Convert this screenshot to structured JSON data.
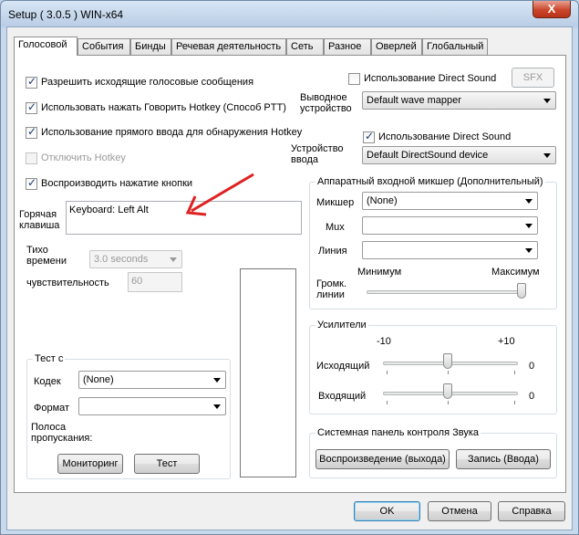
{
  "window": {
    "title": "Setup ( 3.0.5 ) WIN-x64",
    "close_label": "X"
  },
  "tabs": [
    {
      "label": "Голосовой",
      "active": true
    },
    {
      "label": "События"
    },
    {
      "label": "Бинды"
    },
    {
      "label": "Речевая деятельность"
    },
    {
      "label": "Сеть"
    },
    {
      "label": "Разное"
    },
    {
      "label": "Оверлей"
    },
    {
      "label": "Глобальный"
    }
  ],
  "voice": {
    "allow_outgoing": "Разрешить исходящие голосовые сообщения",
    "use_ptt": "Использовать нажать Говорить Hotkey (Способ PTT)",
    "use_direct_detect": "Использование прямого ввода для обнаружения Hotkey",
    "disable_hotkey": "Отключить Hotkey",
    "play_key_press": "Воспроизводить нажатие кнопки",
    "hotkey_label": "Горячая\nклавиша",
    "hotkey_value": "Keyboard: Left Alt",
    "silence_label": "Тихо\nвремени",
    "silence_value": "3.0 seconds",
    "sensitivity_label": "чувствительность",
    "sensitivity_value": "60"
  },
  "output": {
    "use_direct_sound": "Использование Direct Sound",
    "sfx_button": "SFX",
    "device_label": "Выводное\nустройство",
    "device_value": "Default wave mapper"
  },
  "input": {
    "use_direct_sound": "Использование Direct Sound",
    "device_label": "Устройство\nввода",
    "device_value": "Default DirectSound device"
  },
  "mixer": {
    "title": "Аппаратный входной микшер (Дополнительный)",
    "mixer_label": "Микшер",
    "mixer_value": "(None)",
    "mux_label": "Mux",
    "line_label": "Линия",
    "volume_label": "Громк.\nлинии",
    "min_label": "Минимум",
    "max_label": "Максимум"
  },
  "amps": {
    "title": "Усилители",
    "min_label": "-10",
    "max_label": "+10",
    "outgoing_label": "Исходящий",
    "outgoing_value": "0",
    "incoming_label": "Входящий",
    "incoming_value": "0"
  },
  "sound_panel": {
    "title": "Системная панель контроля Звука",
    "playback_button": "Воспроизведение (выхода)",
    "record_button": "Запись (Ввода)"
  },
  "test": {
    "title": "Тест с",
    "codec_label": "Кодек",
    "codec_value": "(None)",
    "format_label": "Формат",
    "bandwidth_label": "Полоса\nпропускания:",
    "monitor_button": "Мониторинг",
    "test_button": "Тест"
  },
  "footer": {
    "ok": "OK",
    "cancel": "Отмена",
    "help": "Справка"
  },
  "colors": {
    "annotation_arrow": "#e02020",
    "accent_border": "#3c7fb1"
  }
}
